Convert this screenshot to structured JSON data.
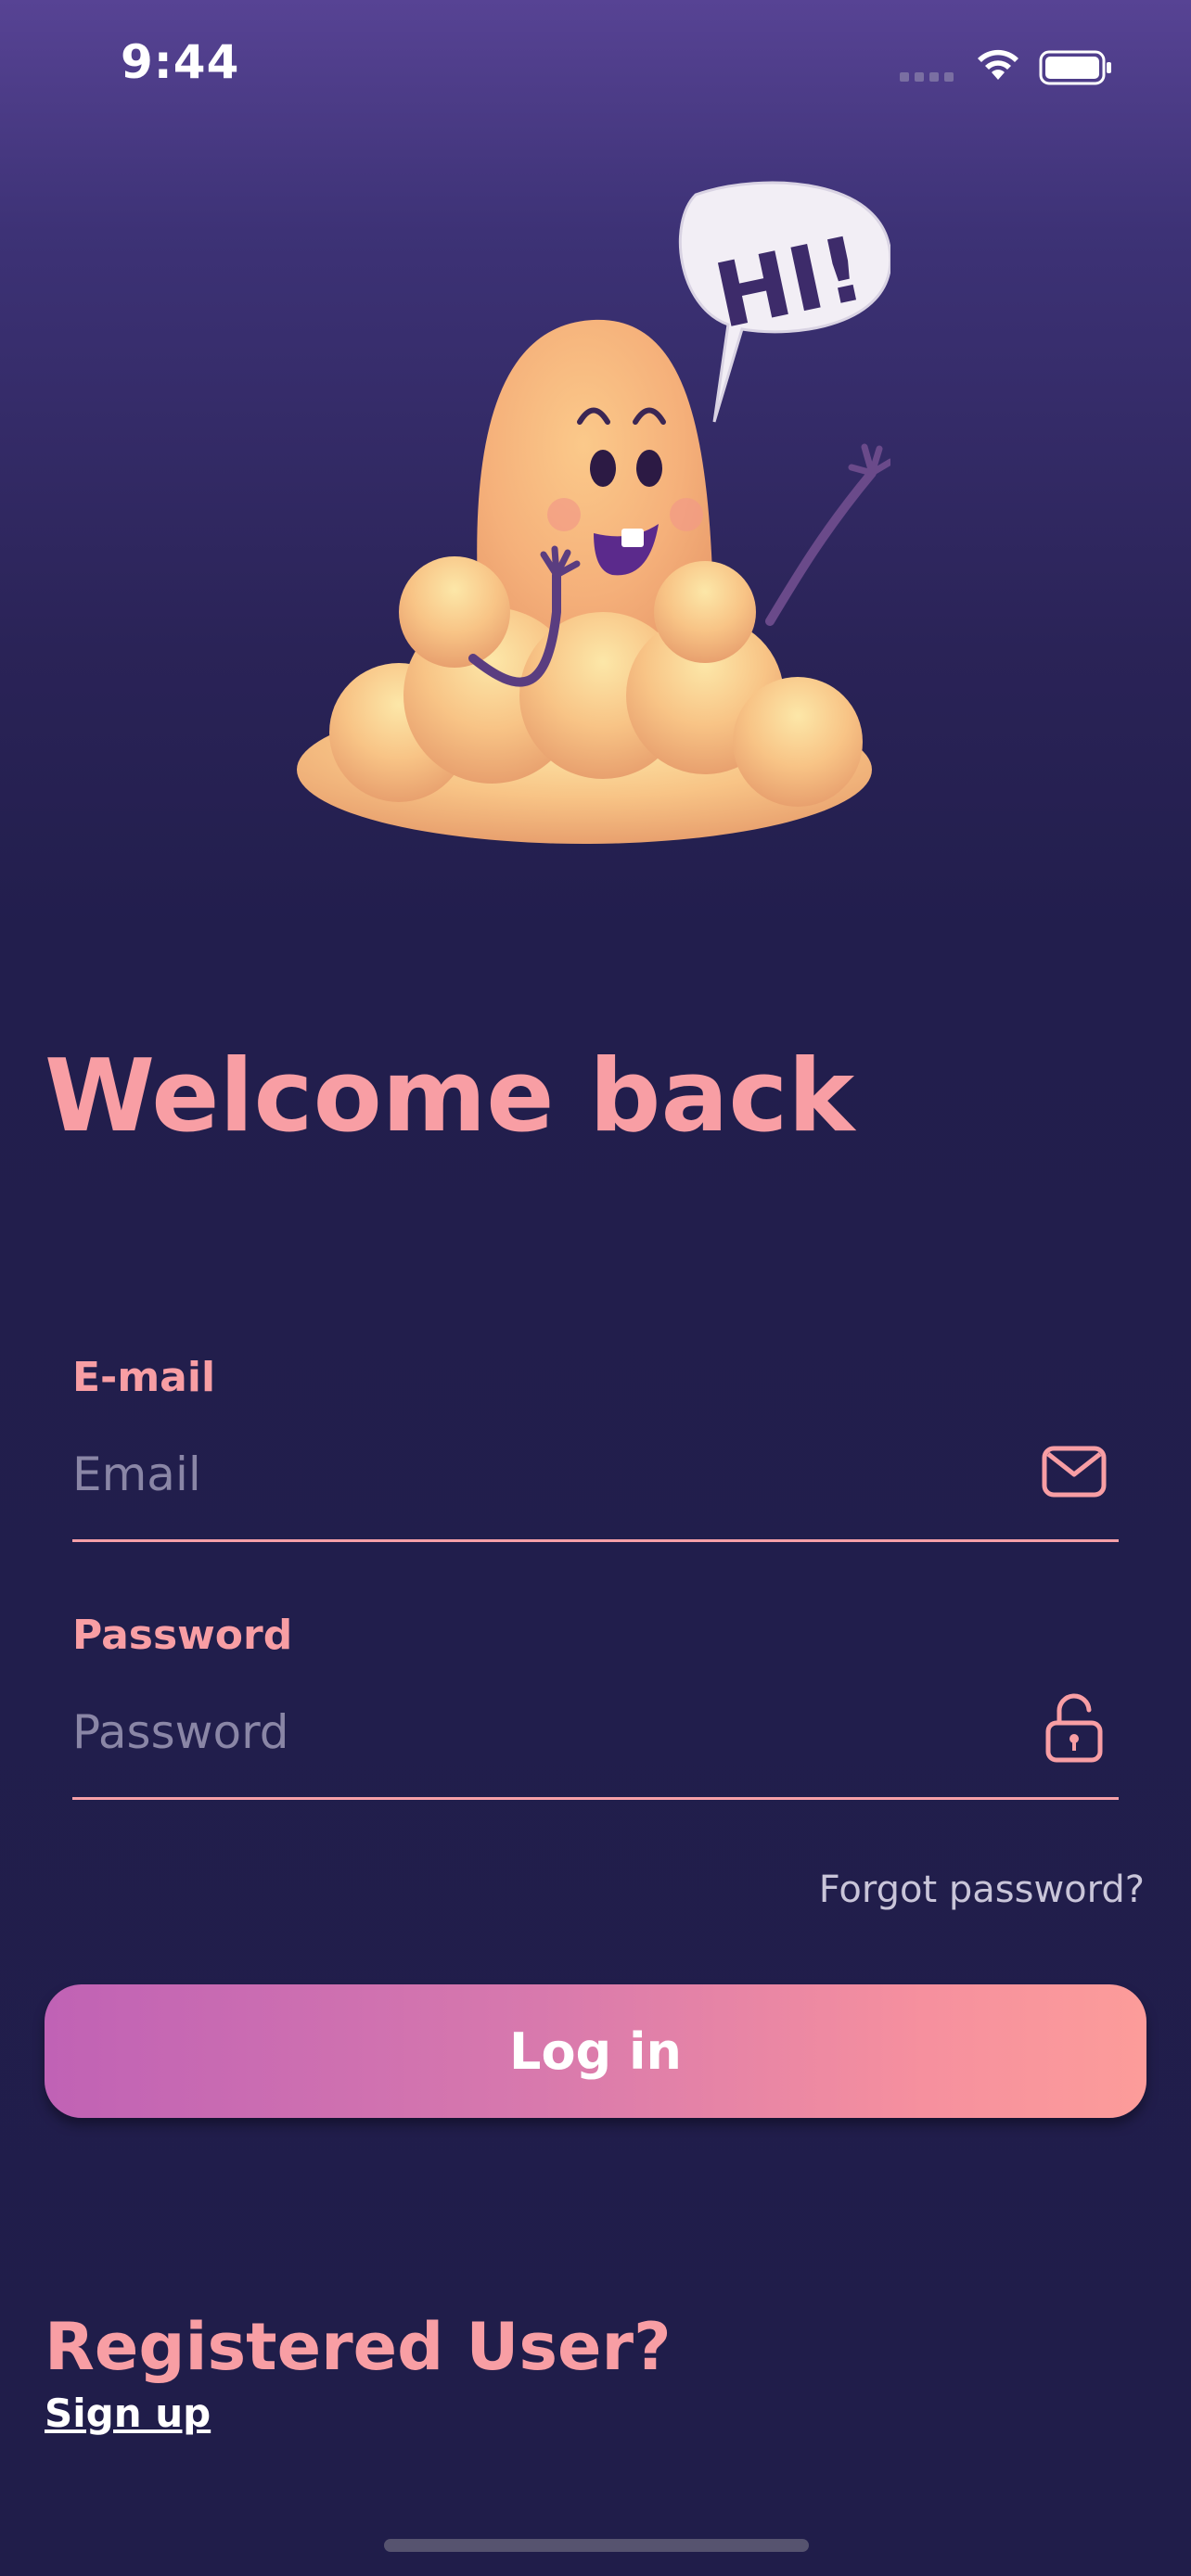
{
  "status_bar": {
    "time": "9:44",
    "icons": [
      "signal-icon",
      "wifi-icon",
      "battery-icon"
    ]
  },
  "hero": {
    "illustration": "waving-cloud-mascot",
    "speech_text": "HI!"
  },
  "title": "Welcome back",
  "email": {
    "label": "E-mail",
    "placeholder": "Email",
    "value": "",
    "icon": "mail-icon"
  },
  "password": {
    "label": "Password",
    "placeholder": "Password",
    "value": "",
    "icon": "unlock-icon"
  },
  "forgot_password": "Forgot password?",
  "login_button": "Log in",
  "registered": {
    "heading": "Registered User?",
    "link": "Sign up"
  },
  "colors": {
    "accent": "#f89ea4",
    "background_top": "#574394",
    "background_bottom": "#201d4a",
    "button_gradient_start": "#c062b5",
    "button_gradient_end": "#fc9c9a"
  }
}
